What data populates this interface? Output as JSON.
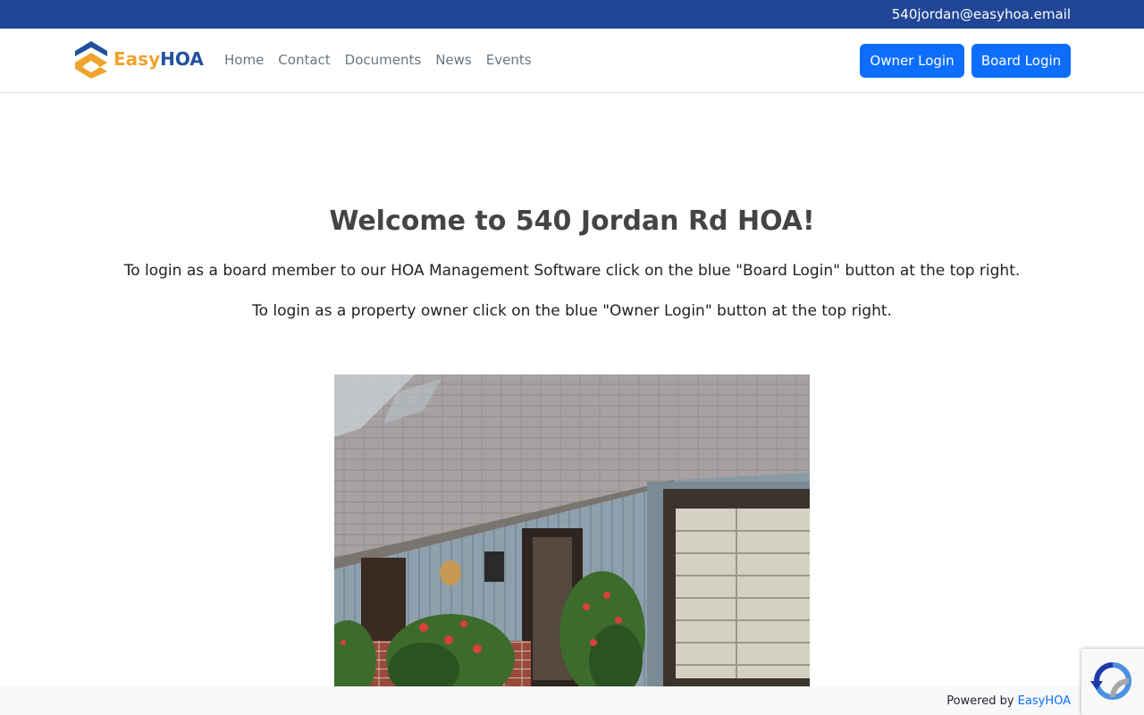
{
  "topbar": {
    "email": "540jordan@easyhoa.email"
  },
  "brand": {
    "easy": "Easy",
    "hoa": "HOA"
  },
  "nav": {
    "links": [
      "Home",
      "Contact",
      "Documents",
      "News",
      "Events"
    ],
    "owner_login": "Owner Login",
    "board_login": "Board Login"
  },
  "hero": {
    "title": "Welcome to 540 Jordan Rd HOA!",
    "line1": "To login as a board member to our HOA Management Software click on the blue \"Board Login\" button at the top right.",
    "line2": "To login as a property owner click on the blue \"Owner Login\" button at the top right."
  },
  "footer": {
    "prefix": "Powered by ",
    "link": "EasyHOA"
  },
  "colors": {
    "topbar": "#214696",
    "primary_button": "#0d6efd",
    "logo_orange": "#f0a32c",
    "logo_blue": "#23519e"
  }
}
